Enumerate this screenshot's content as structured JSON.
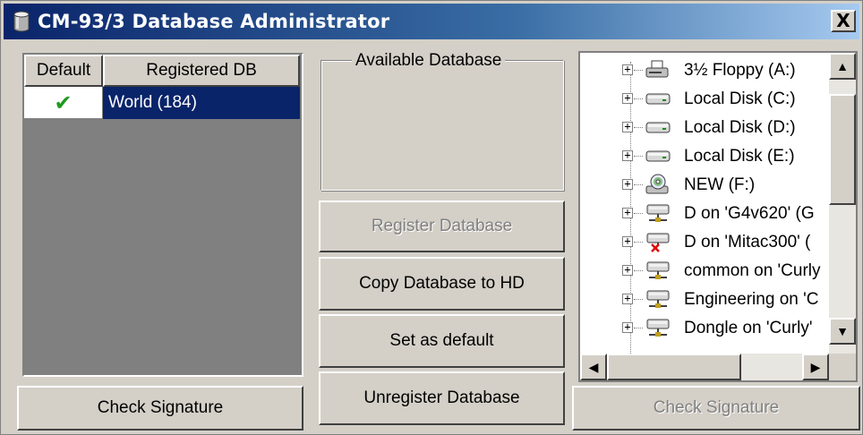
{
  "window": {
    "title": "CM-93/3 Database Administrator",
    "close_label": "X"
  },
  "grid": {
    "headers": [
      "Default",
      "Registered DB"
    ],
    "rows": [
      {
        "default": "✔",
        "name": "World (184)"
      }
    ]
  },
  "available": {
    "label": "Available Database"
  },
  "buttons": {
    "register": "Register Database",
    "copy": "Copy Database to HD",
    "set_default": "Set as default",
    "unregister": "Unregister Database",
    "check_signature_left": "Check Signature",
    "check_signature_right": "Check Signature"
  },
  "tree": {
    "items": [
      {
        "label": "3½ Floppy (A:)",
        "icon": "floppy-drive-icon"
      },
      {
        "label": "Local Disk (C:)",
        "icon": "hard-drive-icon"
      },
      {
        "label": "Local Disk (D:)",
        "icon": "hard-drive-icon"
      },
      {
        "label": "Local Disk (E:)",
        "icon": "hard-drive-icon"
      },
      {
        "label": "NEW (F:)",
        "icon": "cd-drive-icon"
      },
      {
        "label": "D on 'G4v620' (G",
        "icon": "network-drive-icon"
      },
      {
        "label": "D on 'Mitac300' (",
        "icon": "disconnected-network-drive-icon"
      },
      {
        "label": "common on 'Curly",
        "icon": "network-drive-icon"
      },
      {
        "label": "Engineering on 'C",
        "icon": "network-drive-icon"
      },
      {
        "label": "Dongle on 'Curly'",
        "icon": "network-drive-icon"
      }
    ]
  },
  "colors": {
    "selection": "#0a246a",
    "check": "#1e9a1e",
    "face": "#d4d0c8"
  }
}
